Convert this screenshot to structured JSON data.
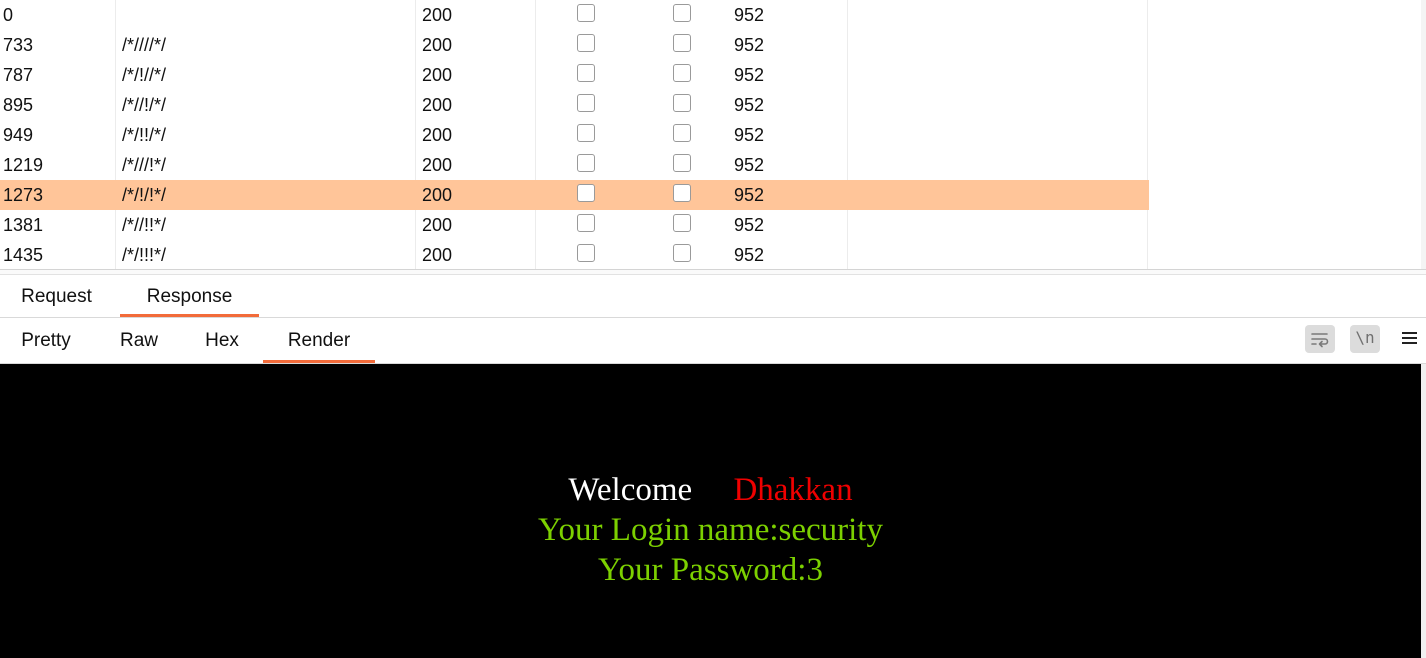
{
  "results": {
    "selected_index": 6,
    "rows": [
      {
        "num": "0",
        "payload": "",
        "status": "200",
        "error": false,
        "timeout": false,
        "length": "952"
      },
      {
        "num": "733",
        "payload": "/*////*/",
        "status": "200",
        "error": false,
        "timeout": false,
        "length": "952"
      },
      {
        "num": "787",
        "payload": "/*/!//*/",
        "status": "200",
        "error": false,
        "timeout": false,
        "length": "952"
      },
      {
        "num": "895",
        "payload": "/*//!/*/",
        "status": "200",
        "error": false,
        "timeout": false,
        "length": "952"
      },
      {
        "num": "949",
        "payload": "/*/!!/*/",
        "status": "200",
        "error": false,
        "timeout": false,
        "length": "952"
      },
      {
        "num": "1219",
        "payload": "/*///!*/",
        "status": "200",
        "error": false,
        "timeout": false,
        "length": "952"
      },
      {
        "num": "1273",
        "payload": "/*/!/!*/",
        "status": "200",
        "error": false,
        "timeout": false,
        "length": "952"
      },
      {
        "num": "1381",
        "payload": "/*//!!*/",
        "status": "200",
        "error": false,
        "timeout": false,
        "length": "952"
      },
      {
        "num": "1435",
        "payload": "/*/!!!*/",
        "status": "200",
        "error": false,
        "timeout": false,
        "length": "952"
      }
    ]
  },
  "main_tabs": [
    {
      "label": "Request",
      "active": false
    },
    {
      "label": "Response",
      "active": true
    }
  ],
  "view_tabs": [
    {
      "label": "Pretty",
      "active": false
    },
    {
      "label": "Raw",
      "active": false
    },
    {
      "label": "Hex",
      "active": false
    },
    {
      "label": "Render",
      "active": true
    }
  ],
  "toolbar": {
    "wrap_icon": "wrap-lines-icon",
    "newline_label": "\\n",
    "menu_icon": "hamburger-menu-icon"
  },
  "render": {
    "welcome": "Welcome",
    "username": "Dhakkan",
    "login_name": "Your Login name:security",
    "password": "Your Password:3"
  },
  "colors": {
    "selected_row": "#ffc599",
    "tab_accent": "#f26b3a",
    "render_bg": "#000000",
    "welcome_text": "#ffffff",
    "username_text": "#f00000",
    "credential_text": "#7cd000"
  }
}
